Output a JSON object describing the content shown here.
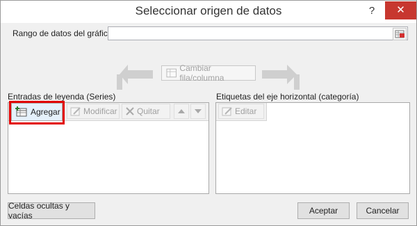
{
  "window": {
    "title": "Seleccionar origen de datos",
    "help_glyph": "?",
    "close_glyph": "✕"
  },
  "range": {
    "label": "Rango de datos del gráfico:",
    "value": ""
  },
  "switch_button": {
    "label": "Cambiar fila/columna",
    "enabled": false
  },
  "series": {
    "label": "Entradas de leyenda (Series)",
    "toolbar": {
      "add": "Agregar",
      "edit": "Modificar",
      "remove": "Quitar"
    },
    "items": []
  },
  "axis": {
    "label": "Etiquetas del eje horizontal (categoría)",
    "toolbar": {
      "edit": "Editar"
    },
    "items": []
  },
  "footer": {
    "hidden_cells": "Celdas ocultas y vacías",
    "ok": "Aceptar",
    "cancel": "Cancelar"
  },
  "colors": {
    "close_bg": "#c7372f",
    "highlight": "#e20000",
    "disabled_text": "#a0a0a0"
  }
}
